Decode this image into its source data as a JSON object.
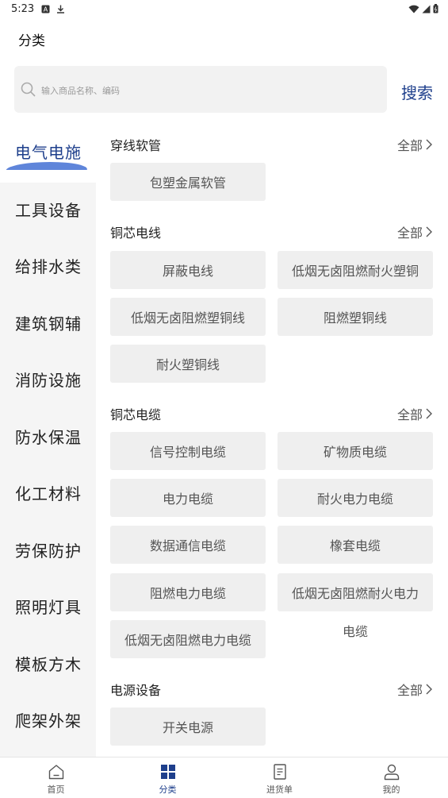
{
  "status": {
    "time": "5:23"
  },
  "header": {
    "title": "分类"
  },
  "search": {
    "placeholder": "输入商品名称、编码",
    "button_label": "搜索"
  },
  "sidebar": {
    "items": [
      {
        "label": "电气电施",
        "active": true
      },
      {
        "label": "工具设备"
      },
      {
        "label": "给排水类"
      },
      {
        "label": "建筑钢辅"
      },
      {
        "label": "消防设施"
      },
      {
        "label": "防水保温"
      },
      {
        "label": "化工材料"
      },
      {
        "label": "劳保防护"
      },
      {
        "label": "照明灯具"
      },
      {
        "label": "模板方木"
      },
      {
        "label": "爬架外架"
      }
    ]
  },
  "sections": [
    {
      "title": "穿线软管",
      "all_label": "全部",
      "chips": [
        "包塑金属软管"
      ]
    },
    {
      "title": "铜芯电线",
      "all_label": "全部",
      "chips": [
        "屏蔽电线",
        "低烟无卤阻燃耐火塑铜",
        "低烟无卤阻燃塑铜线",
        "阻燃塑铜线",
        "耐火塑铜线"
      ]
    },
    {
      "title": "铜芯电缆",
      "all_label": "全部",
      "chips": [
        "信号控制电缆",
        "矿物质电缆",
        "电力电缆",
        "耐火电力电缆",
        "数据通信电缆",
        "橡套电缆",
        "阻燃电力电缆",
        "低烟无卤阻燃耐火电力",
        "低烟无卤阻燃电力电缆"
      ],
      "overflow_text": "电缆"
    },
    {
      "title": "电源设备",
      "all_label": "全部",
      "chips": [
        "开关电源"
      ]
    }
  ],
  "tabbar": {
    "tabs": [
      {
        "label": "首页",
        "icon": "home-icon"
      },
      {
        "label": "分类",
        "icon": "grid-icon",
        "active": true
      },
      {
        "label": "进货单",
        "icon": "document-icon"
      },
      {
        "label": "我的",
        "icon": "person-icon"
      }
    ]
  },
  "colors": {
    "accent": "#1e3f8c",
    "swoosh": "#4e78d6",
    "chip_bg": "#efefef",
    "sidebar_bg": "#f5f5f5"
  }
}
